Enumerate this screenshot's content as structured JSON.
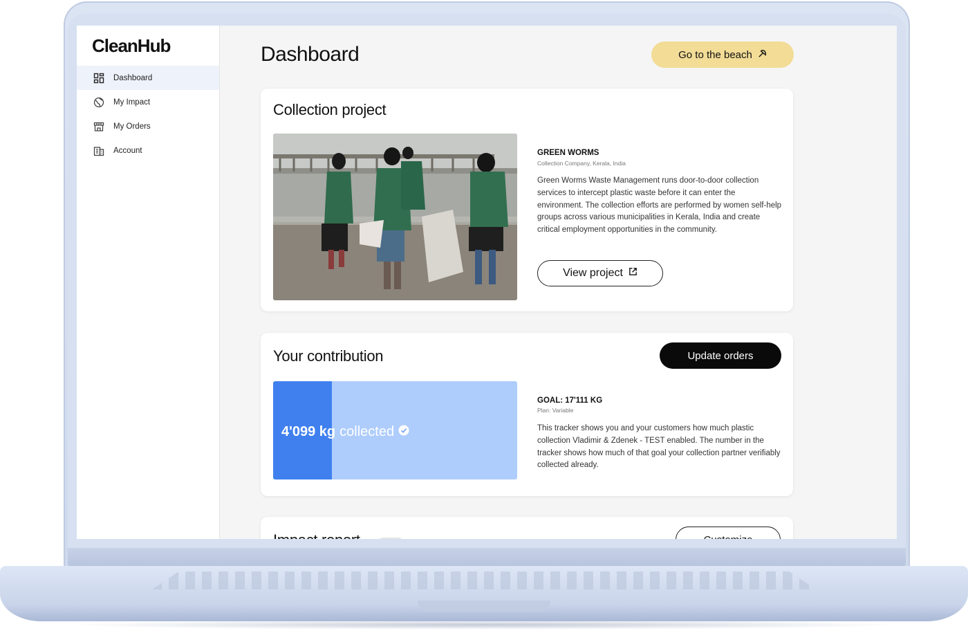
{
  "sidebar": {
    "logo": "CleanHub",
    "items": [
      {
        "label": "Dashboard",
        "icon": "grid-icon",
        "active": true
      },
      {
        "label": "My Impact",
        "icon": "globe-icon",
        "active": false
      },
      {
        "label": "My Orders",
        "icon": "store-icon",
        "active": false
      },
      {
        "label": "Account",
        "icon": "building-icon",
        "active": false
      }
    ]
  },
  "header": {
    "title": "Dashboard",
    "beach_button": "Go to the beach",
    "beach_icon": "umbrella-icon"
  },
  "collection_project": {
    "title": "Collection project",
    "photo": "women-collecting-plastic-on-beach",
    "company": "GREEN WORMS",
    "company_subtitle": "Collection Company, Kerala, India",
    "description": "Green Worms Waste Management runs door-to-door collection services to intercept plastic waste before it can enter the environment. The collection efforts are performed by women self-help groups across various municipalities in Kerala, India and create critical employment opportunities in the community.",
    "view_button": "View project",
    "view_icon": "external-link-icon"
  },
  "contribution": {
    "title": "Your contribution",
    "update_button": "Update orders",
    "collected_amount": "4'099 kg",
    "collected_word": "collected",
    "collected_kg": 4099,
    "goal_kg": 17111,
    "progress_fraction": 0.24,
    "goal": "GOAL: 17'111 KG",
    "plan": "Plan: Variable",
    "description": "This tracker shows you and your customers how much plastic collection Vladimir & Zdenek - TEST enabled. The number in the tracker shows how much of that goal your collection partner verifiably collected already."
  },
  "impact_report": {
    "title": "Impact report",
    "customize_button": "Customize"
  },
  "colors": {
    "accent_yellow": "#f2dc96",
    "tracker_fill": "#3f80ee",
    "tracker_bg": "#aecdfd",
    "active_nav": "#eef2fb"
  }
}
